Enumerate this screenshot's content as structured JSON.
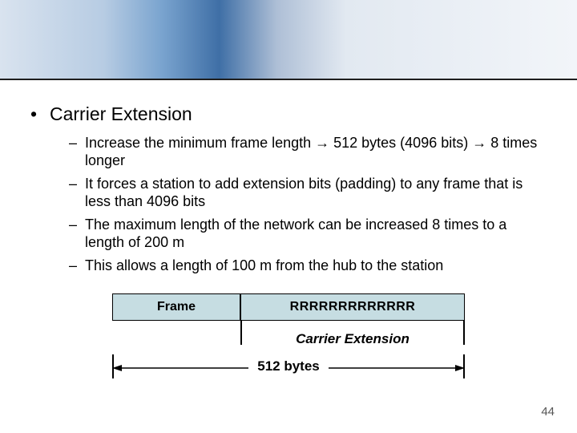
{
  "title": "Carrier Extension",
  "bullets": [
    "Increase the minimum frame length → 512 bytes (4096 bits) → 8 times longer",
    "It forces a station to add extension bits (padding) to any frame that is less than 4096 bits",
    "The maximum length of the network can be increased 8 times to a length of 200 m",
    "This allows a length of 100 m from the hub to the station"
  ],
  "diagram": {
    "frame_label": "Frame",
    "extension_fill": "RRRRRRRRRRRRR",
    "extension_label": "Carrier Extension",
    "total_label": "512 bytes"
  },
  "page_number": "44"
}
